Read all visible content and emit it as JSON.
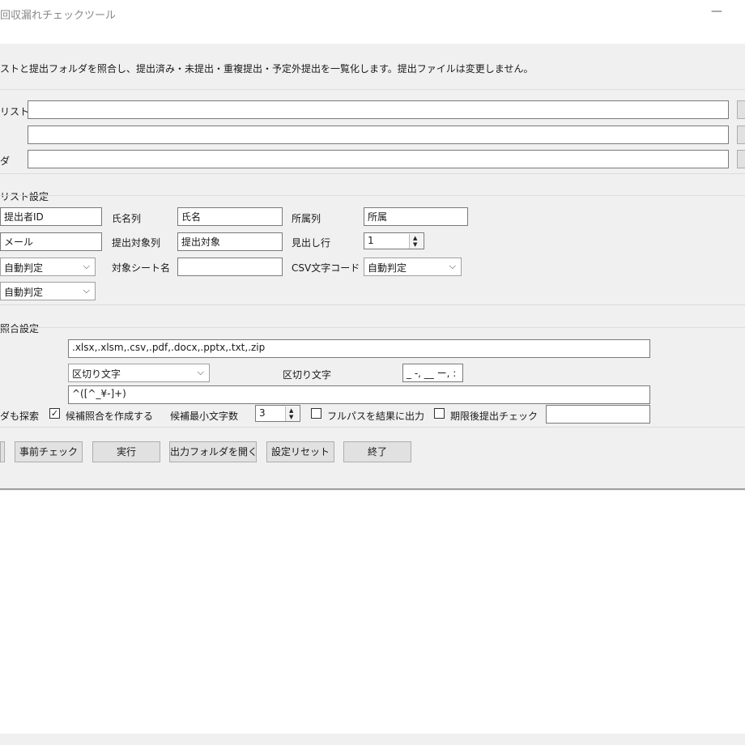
{
  "window": {
    "title": "回収漏れチェックツール",
    "minimize_glyph": "—"
  },
  "description": "ストと提出フォルダを照合し、提出済み・未提出・重複提出・予定外提出を一覧化します。提出ファイルは変更しません。",
  "paths": {
    "row1_label": "リスト",
    "row2_label": "",
    "row3_label": "ダ",
    "row1_value": "",
    "row2_value": "",
    "row3_value": ""
  },
  "list_settings": {
    "section_label": "リスト設定",
    "id_value": "提出者ID",
    "name_col_label": "氏名列",
    "name_col_value": "氏名",
    "dept_col_label": "所属列",
    "dept_col_value": "所属",
    "mail_value": "メール",
    "target_col_label": "提出対象列",
    "target_col_value": "提出対象",
    "header_row_label": "見出し行",
    "header_row_value": "1",
    "combo1_value": "自動判定",
    "sheet_label": "対象シート名",
    "sheet_value": "",
    "csv_label": "CSV文字コード",
    "csv_value": "自動判定",
    "combo2_value": "自動判定"
  },
  "match_settings": {
    "section_label": "照合設定",
    "extensions": ".xlsx,.xlsm,.csv,.pdf,.docx,.pptx,.txt,.zip",
    "delimiter_mode": "区切り文字",
    "delimiter_label": "区切り文字",
    "delimiter_value": "_ -, __ ー, :",
    "regex": "^([^_¥-]+)",
    "subfolder_label": "ダも探索",
    "candidate_label": "候補照合を作成する",
    "candidate_checked": true,
    "min_chars_label": "候補最小文字数",
    "min_chars_value": "3",
    "fullpath_label": "フルパスを結果に出力",
    "fullpath_checked": false,
    "deadline_label": "期限後提出チェック",
    "deadline_checked": false,
    "deadline_value": ""
  },
  "actions": {
    "precheck": "事前チェック",
    "run": "実行",
    "open_output": "出力フォルダを開く",
    "reset": "設定リセット",
    "exit": "終了"
  },
  "icons": {
    "chevron": "chevron-down-icon",
    "spin": "spin-arrows-icon",
    "check": "checkmark-icon"
  }
}
